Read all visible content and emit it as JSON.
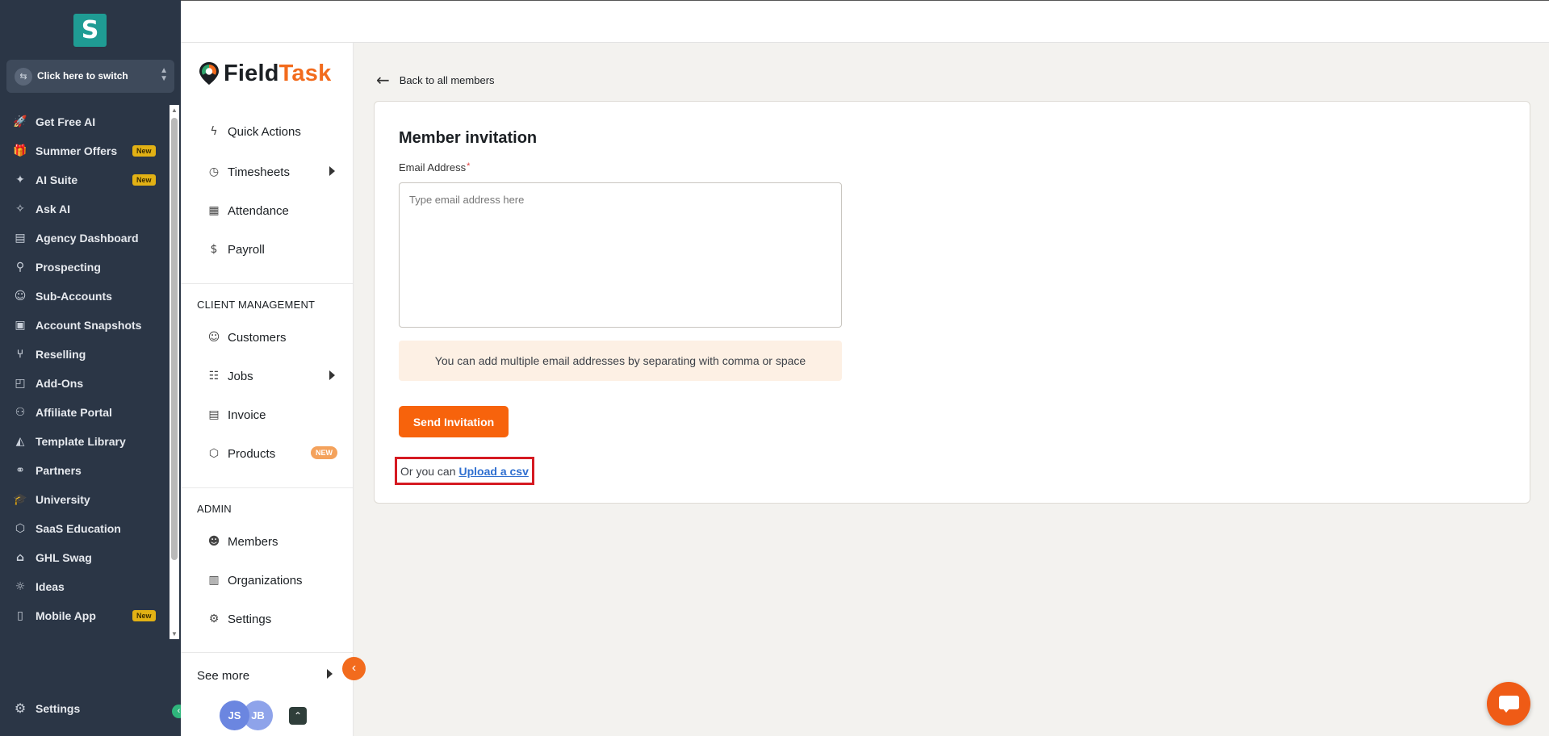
{
  "dark_sidebar": {
    "logo": "S",
    "switcher_label": "Click here to switch",
    "items": [
      {
        "label": "Get Free AI",
        "icon": "rocket-icon",
        "glyph": "🚀",
        "badge": ""
      },
      {
        "label": "Summer Offers",
        "icon": "gift-icon",
        "glyph": "🎁",
        "badge": "New"
      },
      {
        "label": "AI Suite",
        "icon": "sparkle-icon",
        "glyph": "✦",
        "badge": "New"
      },
      {
        "label": "Ask AI",
        "icon": "sparkles-icon",
        "glyph": "✧",
        "badge": ""
      },
      {
        "label": "Agency Dashboard",
        "icon": "dashboard-icon",
        "glyph": "▤",
        "badge": ""
      },
      {
        "label": "Prospecting",
        "icon": "user-search-icon",
        "glyph": "⚲",
        "badge": ""
      },
      {
        "label": "Sub-Accounts",
        "icon": "user-icon",
        "glyph": "☺",
        "badge": ""
      },
      {
        "label": "Account Snapshots",
        "icon": "snapshot-icon",
        "glyph": "▣",
        "badge": ""
      },
      {
        "label": "Reselling",
        "icon": "reselling-icon",
        "glyph": "⑂",
        "badge": ""
      },
      {
        "label": "Add-Ons",
        "icon": "bag-icon",
        "glyph": "◰",
        "badge": ""
      },
      {
        "label": "Affiliate Portal",
        "icon": "users-icon",
        "glyph": "⚇",
        "badge": ""
      },
      {
        "label": "Template Library",
        "icon": "shapes-icon",
        "glyph": "◭",
        "badge": ""
      },
      {
        "label": "Partners",
        "icon": "handshake-icon",
        "glyph": "⚭",
        "badge": ""
      },
      {
        "label": "University",
        "icon": "graduation-cap-icon",
        "glyph": "🎓",
        "badge": ""
      },
      {
        "label": "SaaS Education",
        "icon": "box-icon",
        "glyph": "⬡",
        "badge": ""
      },
      {
        "label": "GHL Swag",
        "icon": "store-icon",
        "glyph": "⌂",
        "badge": ""
      },
      {
        "label": "Ideas",
        "icon": "lightbulb-icon",
        "glyph": "☼",
        "badge": ""
      },
      {
        "label": "Mobile App",
        "icon": "mobile-icon",
        "glyph": "▯",
        "badge": "New"
      }
    ],
    "settings_label": "Settings"
  },
  "field_sidebar": {
    "brand_first": "Field",
    "brand_second": "Task",
    "quick_actions": "Quick Actions",
    "timesheets": "Timesheets",
    "attendance": "Attendance",
    "payroll": "Payroll",
    "client_header": "CLIENT MANAGEMENT",
    "customers": "Customers",
    "jobs": "Jobs",
    "invoice": "Invoice",
    "products": "Products",
    "products_badge": "NEW",
    "admin_header": "ADMIN",
    "members": "Members",
    "organizations": "Organizations",
    "settings": "Settings",
    "see_more": "See more",
    "avatar1": "JS",
    "avatar2": "JB"
  },
  "main": {
    "back_label": "Back to all members",
    "title": "Member invitation",
    "email_label": "Email Address",
    "email_required": "*",
    "email_placeholder": "Type email address here",
    "email_value": "",
    "hint": "You can add multiple email addresses by separating with comma or space",
    "send_label": "Send Invitation",
    "csv_prefix": "Or you can",
    "csv_link": "Upload a csv"
  },
  "colors": {
    "accent_orange": "#f7630c",
    "dark_sidebar": "#2b3646",
    "link_blue": "#2f6fd0",
    "highlight_red": "#d51a22"
  }
}
